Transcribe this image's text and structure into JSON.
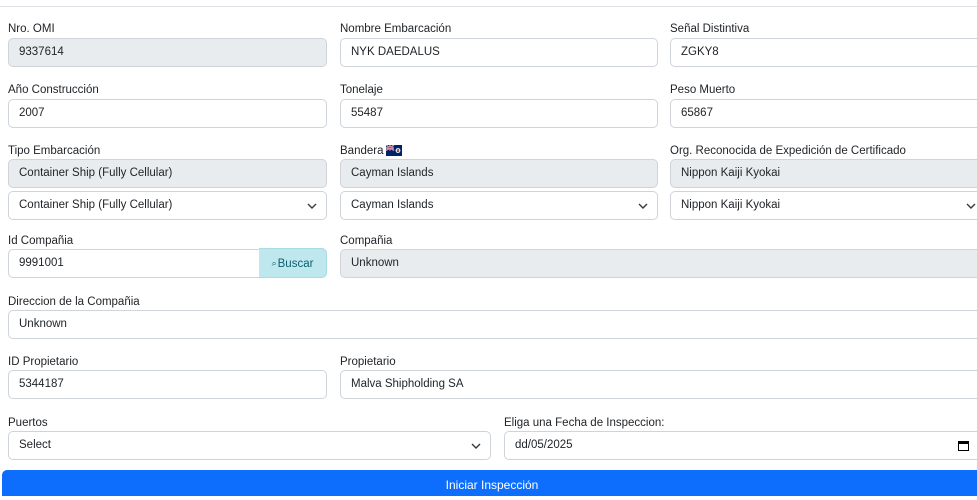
{
  "fields": {
    "nro_omi": {
      "label": "Nro. OMI",
      "value": "9337614"
    },
    "nombre": {
      "label": "Nombre Embarcación",
      "value": "NYK DAEDALUS"
    },
    "senal": {
      "label": "Señal Distintiva",
      "value": "ZGKY8"
    },
    "anio": {
      "label": "Año Construcción",
      "value": "2007"
    },
    "tonelaje": {
      "label": "Tonelaje",
      "value": "55487"
    },
    "peso": {
      "label": "Peso Muerto",
      "value": "65867"
    },
    "tipo": {
      "label": "Tipo Embarcación",
      "value": "Container Ship (Fully Cellular)",
      "selected": "Container Ship (Fully Cellular)"
    },
    "bandera": {
      "label": "Bandera",
      "value": "Cayman Islands",
      "selected": "Cayman Islands",
      "flag_icon": "cayman-islands-flag-icon"
    },
    "org": {
      "label": "Org. Reconocida de Expedición de Certificado",
      "value": "Nippon Kaiji Kyokai",
      "selected": "Nippon Kaiji Kyokai"
    },
    "id_compania": {
      "label": "Id Compañia",
      "value": "9991001"
    },
    "compania": {
      "label": "Compañia",
      "value": "Unknown"
    },
    "direccion": {
      "label": "Direccion de la Compañia",
      "value": "Unknown"
    },
    "id_propietario": {
      "label": "ID Propietario",
      "value": "5344187"
    },
    "propietario": {
      "label": "Propietario",
      "value": "Malva Shipholding SA"
    },
    "puertos": {
      "label": "Puertos",
      "selected": "Select"
    },
    "fecha": {
      "label": "Eliga una Fecha de Inspeccion:",
      "value": "dd/05/2025"
    }
  },
  "buttons": {
    "buscar": "Buscar",
    "iniciar": "Iniciar Inspección"
  },
  "colors": {
    "primary": "#0d6efd",
    "readonly_bg": "#e9ecef",
    "info_btn": "#bfe8ee",
    "border": "#ced4da"
  }
}
